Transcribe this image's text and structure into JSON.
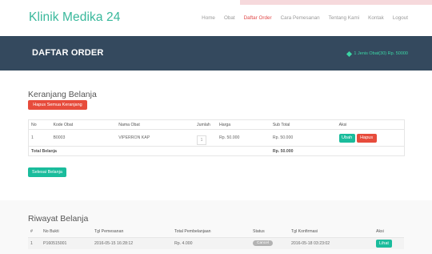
{
  "brand": "Klinik Medika 24",
  "nav": [
    "Home",
    "Obat",
    "Daftar Order",
    "Cara Pemesanan",
    "Tentang Kami",
    "Kontak",
    "Logout"
  ],
  "nav_active": "Daftar Order",
  "header": {
    "title": "DAFTAR ORDER",
    "cart_summary": "1 Jenis Obat(30) Rp. 50000",
    "cart_icon": "tag-icon"
  },
  "cart": {
    "heading": "Keranjang Belanja",
    "clear_button": "Hapus Semua Keranjang",
    "columns": [
      "No",
      "Kode Obat",
      "Nama Obat",
      "Jumlah",
      "Harga",
      "Sub Total",
      "Aksi"
    ],
    "rows": [
      {
        "no": "1",
        "kode": "B0003",
        "nama": "VIPERRON KAP",
        "jumlah": "1",
        "harga": "Rp. 50.000",
        "subtotal": "Rp. 50.000"
      }
    ],
    "edit_label": "Ubah",
    "delete_label": "Hapus",
    "total_label": "Total Belanja",
    "total_value": "Rp. 50.000",
    "checkout_button": "Selesai Belanja"
  },
  "history": {
    "heading": "Riwayat Belanja",
    "columns": [
      "#",
      "No Bukti",
      "Tgl Pemesanan",
      "Total Pembelanjaan",
      "Status",
      "Tgl Konfirmasi",
      "Aksi"
    ],
    "rows": [
      {
        "no": "1",
        "bukti": "P160515001",
        "tgl": "2016-05-15 16:28:12",
        "total": "Rp. 4.000",
        "status": "Cancel",
        "konfirmasi": "2016-05-18 03:23:02",
        "action": "Lihat"
      }
    ]
  },
  "colors": {
    "brand": "#38b89b",
    "header_bg": "#34495e",
    "red": "#e74c3c",
    "green": "#1abc9c",
    "active_nav": "#e04848"
  }
}
